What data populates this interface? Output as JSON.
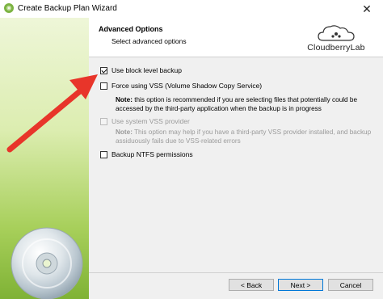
{
  "window": {
    "title": "Create Backup Plan Wizard",
    "close_glyph": "✕"
  },
  "header": {
    "title": "Advanced Options",
    "subtitle": "Select advanced options",
    "logo_text": "CloudberryLab"
  },
  "options": [
    {
      "label": "Use block level backup",
      "checked": true,
      "enabled": true
    },
    {
      "label": "Force using VSS (Volume Shadow Copy Service)",
      "checked": false,
      "enabled": true,
      "note_label": "Note:",
      "note_text": " this option is recommended if you are selecting files that potentially could be accessed by the third-party application when the backup is in progress"
    },
    {
      "label": "Use system VSS provider",
      "checked": false,
      "enabled": false,
      "note_label": "Note:",
      "note_text": " This option may help if you have a third-party VSS provider installed, and backup assiduously fails due to VSS-related errors"
    },
    {
      "label": "Backup NTFS permissions",
      "checked": false,
      "enabled": true
    }
  ],
  "buttons": {
    "back": "< Back",
    "next": "Next >",
    "cancel": "Cancel"
  },
  "colors": {
    "arrow": "#e8352a",
    "side_panel": "#a7cf5a",
    "primary_border": "#0078d7"
  },
  "icons": {
    "app": "cloudberry-icon",
    "close": "close-icon",
    "decor": "disc-icon",
    "overlay": "red-arrow"
  }
}
